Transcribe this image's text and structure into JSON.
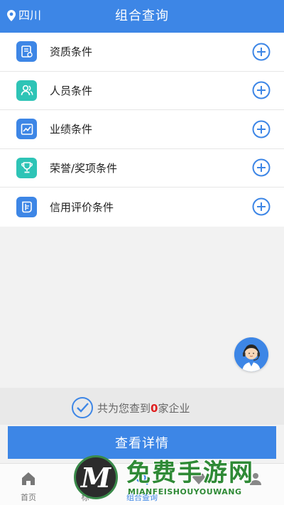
{
  "header": {
    "location": "四川",
    "title": "组合查询",
    "location_icon": "map-pin-icon"
  },
  "conditions": [
    {
      "label": "资质条件",
      "icon": "certificate-icon",
      "icon_color": "#3d86e6"
    },
    {
      "label": "人员条件",
      "icon": "people-icon",
      "icon_color": "#2ec4b6"
    },
    {
      "label": "业绩条件",
      "icon": "chart-icon",
      "icon_color": "#3d86e6"
    },
    {
      "label": "荣誉/奖项条件",
      "icon": "trophy-icon",
      "icon_color": "#2ec4b6"
    },
    {
      "label": "信用评价条件",
      "icon": "shield-icon",
      "icon_color": "#3d86e6"
    }
  ],
  "summary": {
    "prefix": "共为您查到",
    "count": "0",
    "suffix": "家企业"
  },
  "detail_button": "查看详情",
  "tabs": [
    {
      "label": "首页",
      "icon": "home-icon"
    },
    {
      "label": "标",
      "icon": "bid-icon"
    },
    {
      "label": "组合查询",
      "icon": "search-icon"
    },
    {
      "label": "",
      "icon": "diamond-icon"
    },
    {
      "label": "",
      "icon": "user-icon"
    }
  ],
  "watermark": {
    "title": "免费手游网",
    "subtitle": "MIANFEISHOUYOUWANG",
    "logo_letter": "M"
  },
  "colors": {
    "primary": "#3d86e6",
    "teal": "#2ec4b6",
    "count_red": "#e02020"
  }
}
